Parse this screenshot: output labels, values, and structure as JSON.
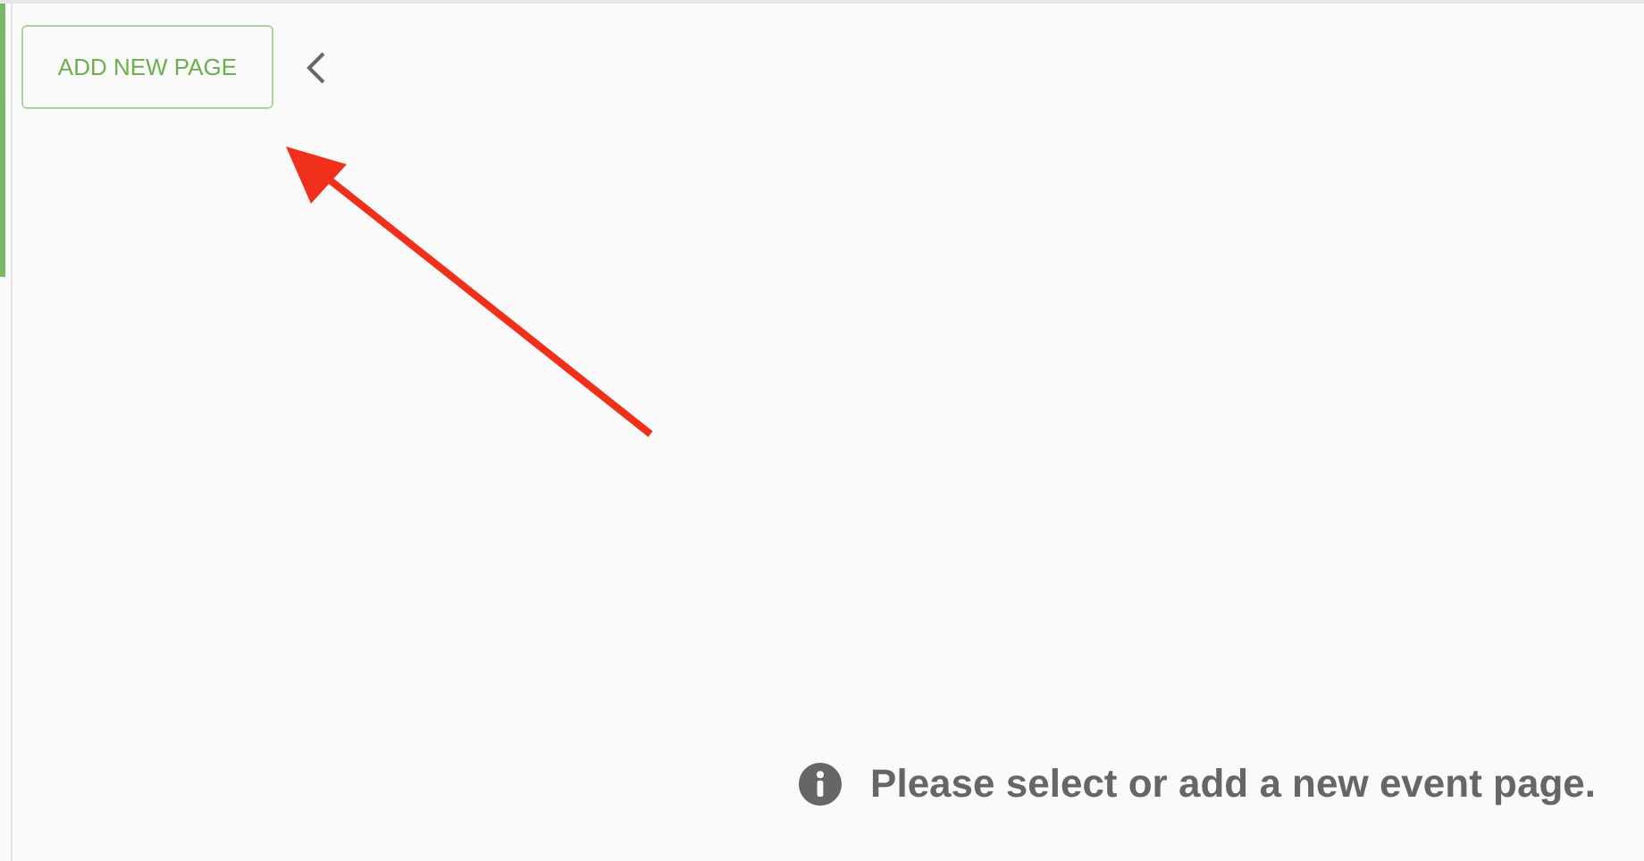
{
  "toolbar": {
    "add_button": "ADD NEW PAGE",
    "collapse": {
      "expanded": true
    }
  },
  "message": "Please select or add a new event page.",
  "annotation": {
    "kind": "arrow"
  }
}
